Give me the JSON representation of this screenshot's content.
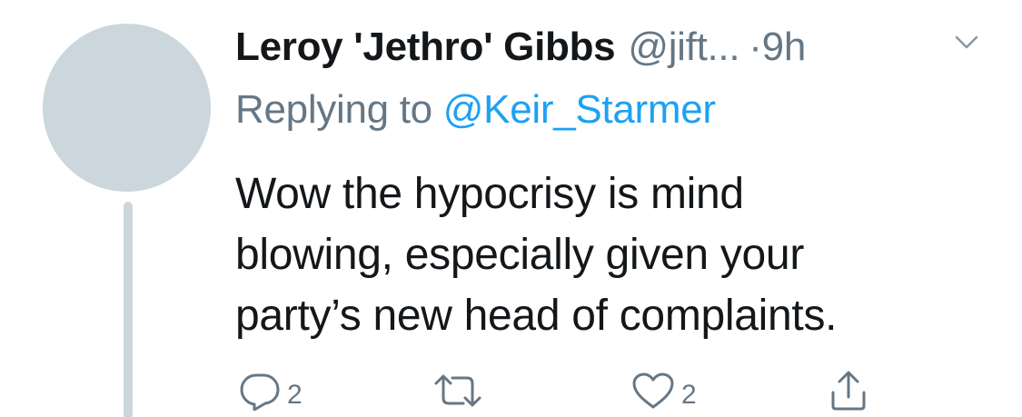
{
  "tweet": {
    "display_name": "Leroy 'Jethro' Gibbs",
    "handle": "@jift...",
    "separator": "·",
    "timestamp": "9h",
    "replying_prefix": "Replying to",
    "replying_to": "@Keir_Starmer",
    "body_lines": [
      "Wow the hypocrisy is mind",
      "blowing, especially given your",
      "party’s new head of complaints."
    ]
  },
  "actions": {
    "reply_count": "2",
    "retweet_count": "",
    "like_count": "2"
  },
  "icons": {
    "reply": "reply-icon",
    "retweet": "retweet-icon",
    "like": "heart-icon",
    "share": "share-icon",
    "menu": "chevron-down-icon"
  },
  "colors": {
    "text": "#14171a",
    "secondary": "#657786",
    "link": "#1da1f2",
    "avatar_placeholder": "#ccd6dd"
  }
}
